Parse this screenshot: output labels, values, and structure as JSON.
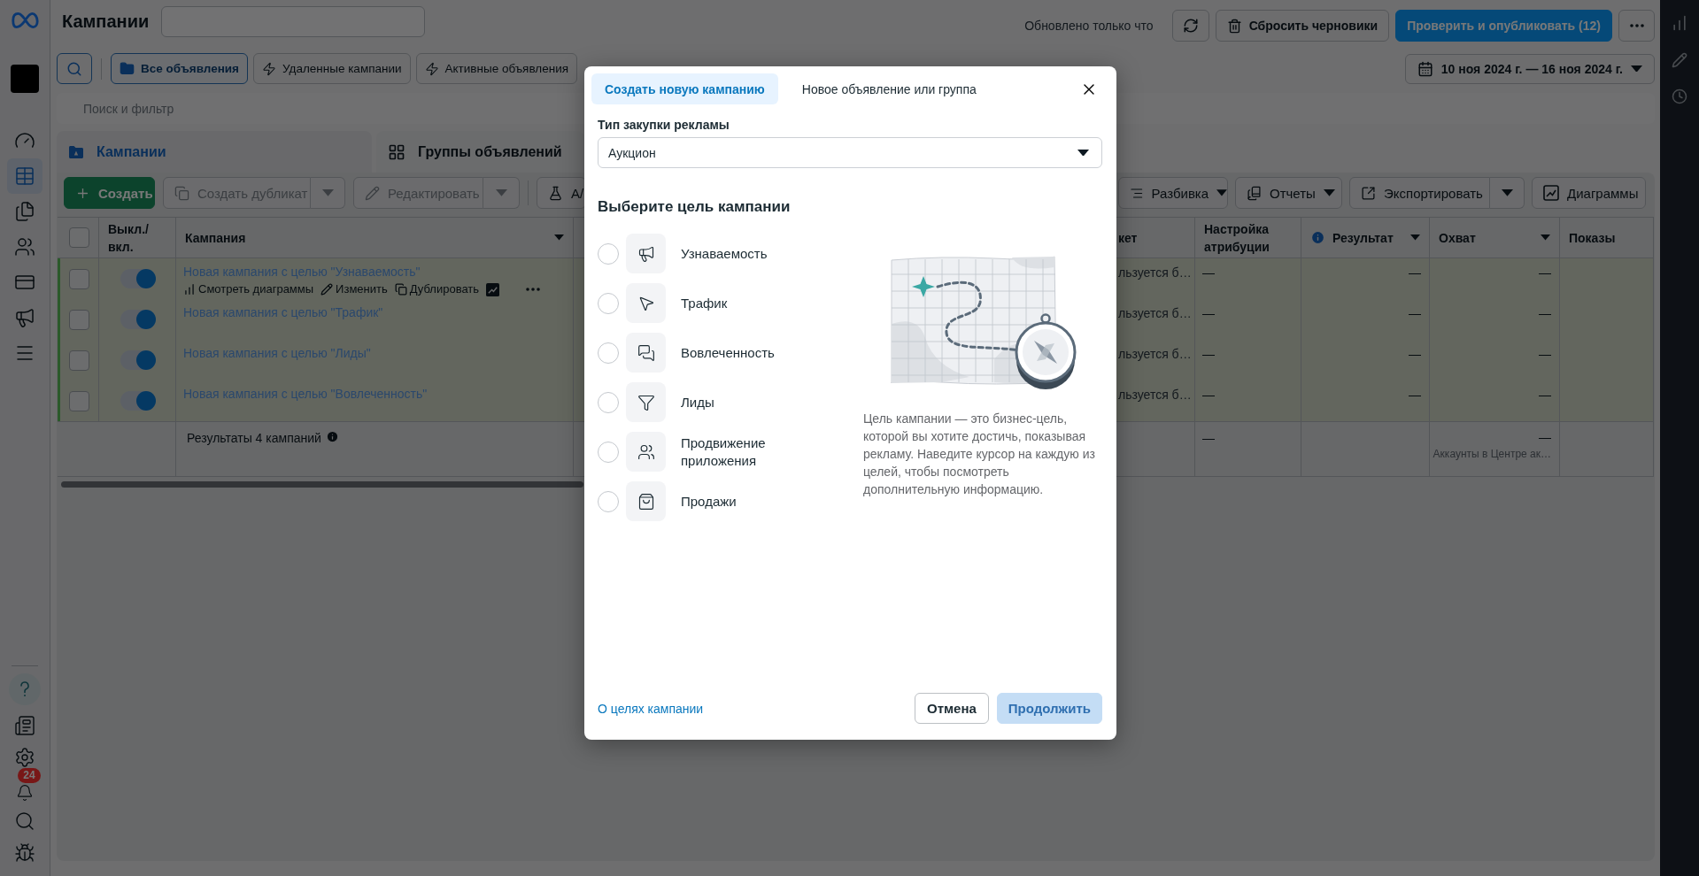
{
  "top_bar": {
    "title": "Кампании",
    "update_status": "Обновлено только что",
    "reset_button": "Сбросить черновики",
    "publish_button": "Проверить и опубликовать (12)"
  },
  "sidebar": {
    "items": [
      {
        "selected": false
      },
      {
        "selected": true
      },
      {
        "selected": false
      },
      {
        "selected": false
      },
      {
        "selected": false
      },
      {
        "selected": false
      },
      {
        "selected": false
      }
    ],
    "notification_count": "24"
  },
  "filters": {
    "presets": [
      {
        "label": "Все объявления",
        "selected": true
      },
      {
        "label": "Удаленные кампании",
        "selected": false
      },
      {
        "label": "Активные объявления",
        "selected": false
      }
    ],
    "date_range": "10 ноя 2024 г. — 16 ноя 2024 г.",
    "search": {
      "placeholder": "Поиск и фильтр"
    }
  },
  "level_tabs": [
    {
      "label": "Кампании",
      "selected": true
    },
    {
      "label": "Группы объявлений",
      "selected": false
    }
  ],
  "toolbar": {
    "left": [
      {
        "label": "Создать",
        "kind": "primary",
        "disabled": false
      },
      {
        "label": "Создать дубликат",
        "kind": "split",
        "disabled": true
      },
      {
        "label": "Редактировать",
        "kind": "split",
        "disabled": true
      },
      {
        "label": "A/",
        "kind": "plain",
        "disabled": false
      }
    ],
    "right": [
      {
        "label": "Разбивка",
        "kind": "dropdown",
        "disabled": false
      },
      {
        "label": "Отчеты",
        "kind": "dropdown",
        "disabled": false
      },
      {
        "label": "Экспортировать",
        "kind": "split",
        "disabled": false
      },
      {
        "label": "Диаграммы",
        "kind": "plain",
        "disabled": false
      }
    ]
  },
  "table": {
    "all_checked": false,
    "columns": [
      {
        "label": "Выкл./ вкл.",
        "kind": "plain"
      },
      {
        "label": "Кампания",
        "kind": "menu"
      },
      {
        "label": "кет",
        "kind": "plain"
      },
      {
        "label": "Настройка атрибуции",
        "kind": "plain"
      },
      {
        "label": "Результат",
        "kind": "metric"
      },
      {
        "label": "Охват",
        "kind": "menu"
      },
      {
        "label": "Показы",
        "kind": "plain"
      }
    ],
    "rows": [
      {
        "checked": false,
        "on": true,
        "draft": true,
        "name": "Новая кампания с целью \"Узнаваемость\"",
        "actions": [
          {
            "label": "Смотреть диаграммы"
          },
          {
            "label": "Изменить"
          },
          {
            "label": "Дублировать"
          }
        ],
        "budget": "льзуется б…",
        "attribution": "—",
        "result": "—",
        "reach": "—"
      },
      {
        "checked": false,
        "on": true,
        "draft": true,
        "name": "Новая кампания с целью \"Трафик\"",
        "budget": "льзуется б…",
        "attribution": "—",
        "result": "—",
        "reach": "—"
      },
      {
        "checked": false,
        "on": true,
        "draft": true,
        "name": "Новая кампания с целью \"Лиды\"",
        "budget": "льзуется б…",
        "attribution": "—",
        "result": "—",
        "reach": "—"
      },
      {
        "checked": false,
        "on": true,
        "draft": true,
        "name": "Новая кампания с целью \"Вовлеченность\"",
        "budget": "льзуется б…",
        "attribution": "—",
        "result": "—",
        "reach": "—"
      }
    ],
    "footer": {
      "label": "Результаты 4 кампаний",
      "attribution": "—",
      "reach": "—",
      "reach_note": "Аккаунты в Центре ак…"
    }
  },
  "modal": {
    "tabs": [
      {
        "label": "Создать новую кампанию",
        "selected": true
      },
      {
        "label": "Новое объявление или группа",
        "selected": false
      }
    ],
    "buying_type": {
      "label": "Тип закупки рекламы",
      "value": "Аукцион"
    },
    "objective_heading": "Выберите цель кампании",
    "objectives": [
      {
        "label": "Узнаваемость",
        "selected": false
      },
      {
        "label": "Трафик",
        "selected": false
      },
      {
        "label": "Вовлеченность",
        "selected": false
      },
      {
        "label": "Лиды",
        "selected": false
      },
      {
        "label": "Продвижение приложения",
        "selected": false
      },
      {
        "label": "Продажи",
        "selected": false
      }
    ],
    "description": "Цель кампании — это бизнес-цель, которой вы хотите достичь, показывая рекламу. Наведите курсор на каждую из целей, чтобы посмотреть дополнительную информацию.",
    "help_link": "О целях кампании",
    "buttons": [
      {
        "label": "Отмена",
        "kind": "secondary",
        "disabled": false
      },
      {
        "label": "Продолжить",
        "kind": "primary",
        "disabled": true
      }
    ]
  }
}
